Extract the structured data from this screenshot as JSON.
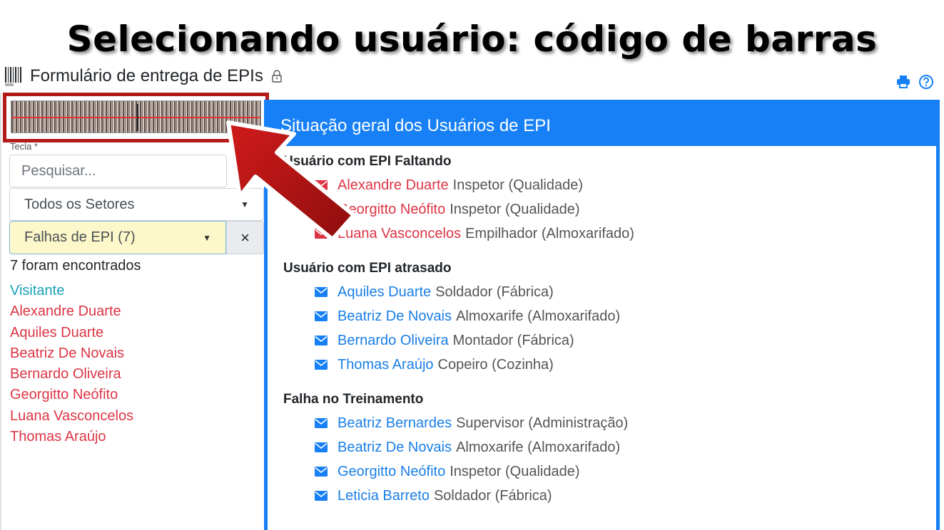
{
  "slide": {
    "title": "Selecionando usuário: código de barras"
  },
  "header": {
    "title": "Formulário de entrega de EPIs"
  },
  "form": {
    "field_label": "Tecla *",
    "search_placeholder": "Pesquisar...",
    "sector_select": "Todos os Setores",
    "filter_select": "Falhas de EPI (7)",
    "clear_label": "×",
    "found_count": "7 foram encontrados"
  },
  "users": [
    {
      "name": "Visitante",
      "kind": "visitor"
    },
    {
      "name": "Alexandre Duarte",
      "kind": "alert"
    },
    {
      "name": "Aquiles Duarte",
      "kind": "alert"
    },
    {
      "name": "Beatriz De Novais",
      "kind": "alert"
    },
    {
      "name": "Bernardo Oliveira",
      "kind": "alert"
    },
    {
      "name": "Georgitto Neófito",
      "kind": "alert"
    },
    {
      "name": "Luana Vasconcelos",
      "kind": "alert"
    },
    {
      "name": "Thomas Araújo",
      "kind": "alert"
    }
  ],
  "panel": {
    "title": "Situação geral dos Usuários de EPI",
    "sections": [
      {
        "title": "Usuário com EPI Faltando",
        "color": "red",
        "entries": [
          {
            "name": "Alexandre Duarte",
            "role": "Inspetor (Qualidade)"
          },
          {
            "name": "Georgitto Neófito",
            "role": "Inspetor (Qualidade)"
          },
          {
            "name": "Luana Vasconcelos",
            "role": "Empilhador (Almoxarifado)"
          }
        ]
      },
      {
        "title": "Usuário com EPI atrasado",
        "color": "blue",
        "entries": [
          {
            "name": "Aquiles Duarte",
            "role": "Soldador (Fábrica)"
          },
          {
            "name": "Beatriz De Novais",
            "role": "Almoxarife (Almoxarifado)"
          },
          {
            "name": "Bernardo Oliveira",
            "role": "Montador (Fábrica)"
          },
          {
            "name": "Thomas Araújo",
            "role": "Copeiro (Cozinha)"
          }
        ]
      },
      {
        "title": "Falha no Treinamento",
        "color": "blue",
        "entries": [
          {
            "name": "Beatriz Bernardes",
            "role": "Supervisor (Administração)"
          },
          {
            "name": "Beatriz De Novais",
            "role": "Almoxarife (Almoxarifado)"
          },
          {
            "name": "Georgitto Neófito",
            "role": "Inspetor (Qualidade)"
          },
          {
            "name": "Leticia Barreto",
            "role": "Soldador (Fábrica)"
          }
        ]
      }
    ]
  },
  "colors": {
    "primary": "#1780f6",
    "danger": "#dc3545",
    "info": "#17a2b8",
    "highlight": "#b31b1b"
  },
  "icons": [
    "barcode-icon",
    "lock-icon",
    "print-icon",
    "help-icon",
    "mail-icon",
    "arrow-pointer"
  ]
}
